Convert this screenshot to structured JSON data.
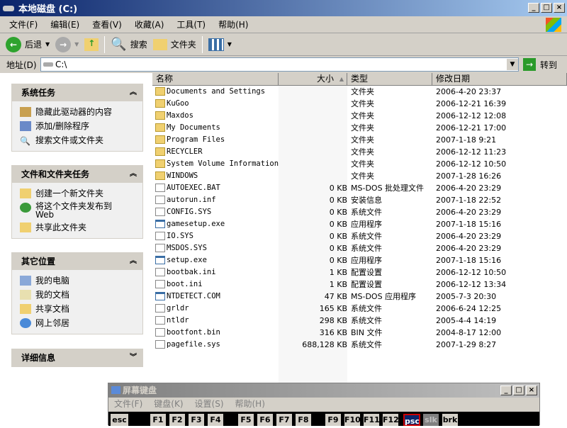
{
  "window": {
    "title": "本地磁盘 (C:)"
  },
  "menu": [
    "文件(F)",
    "编辑(E)",
    "查看(V)",
    "收藏(A)",
    "工具(T)",
    "帮助(H)"
  ],
  "toolbar": {
    "back": "后退",
    "search": "搜索",
    "folders": "文件夹"
  },
  "address": {
    "label": "地址(D)",
    "value": "C:\\",
    "go": "转到"
  },
  "left": {
    "system_tasks": {
      "title": "系统任务",
      "items": [
        "隐藏此驱动器的内容",
        "添加/删除程序",
        "搜索文件或文件夹"
      ]
    },
    "file_tasks": {
      "title": "文件和文件夹任务",
      "items": [
        "创建一个新文件夹",
        "将这个文件夹发布到\nWeb",
        "共享此文件夹"
      ]
    },
    "other_places": {
      "title": "其它位置",
      "items": [
        "我的电脑",
        "我的文档",
        "共享文档",
        "网上邻居"
      ]
    },
    "details": {
      "title": "详细信息"
    }
  },
  "columns": [
    "名称",
    "大小",
    "类型",
    "修改日期"
  ],
  "files": [
    [
      "Documents and Settings",
      "",
      "文件夹",
      "2006-4-20 23:37",
      "folder"
    ],
    [
      "KuGoo",
      "",
      "文件夹",
      "2006-12-21 16:39",
      "folder"
    ],
    [
      "Maxdos",
      "",
      "文件夹",
      "2006-12-12 12:08",
      "folder"
    ],
    [
      "My Documents",
      "",
      "文件夹",
      "2006-12-21 17:00",
      "folder"
    ],
    [
      "Program Files",
      "",
      "文件夹",
      "2007-1-18 9:21",
      "folder"
    ],
    [
      "RECYCLER",
      "",
      "文件夹",
      "2006-12-12 11:23",
      "folder"
    ],
    [
      "System Volume Information",
      "",
      "文件夹",
      "2006-12-12 10:50",
      "folder"
    ],
    [
      "WINDOWS",
      "",
      "文件夹",
      "2007-1-28 16:26",
      "folder"
    ],
    [
      "AUTOEXEC.BAT",
      "0 KB",
      "MS-DOS 批处理文件",
      "2006-4-20 23:29",
      "file"
    ],
    [
      "autorun.inf",
      "0 KB",
      "安装信息",
      "2007-1-18 22:52",
      "file"
    ],
    [
      "CONFIG.SYS",
      "0 KB",
      "系统文件",
      "2006-4-20 23:29",
      "file"
    ],
    [
      "gamesetup.exe",
      "0 KB",
      "应用程序",
      "2007-1-18 15:16",
      "exe"
    ],
    [
      "IO.SYS",
      "0 KB",
      "系统文件",
      "2006-4-20 23:29",
      "file"
    ],
    [
      "MSDOS.SYS",
      "0 KB",
      "系统文件",
      "2006-4-20 23:29",
      "file"
    ],
    [
      "setup.exe",
      "0 KB",
      "应用程序",
      "2007-1-18 15:16",
      "exe"
    ],
    [
      "bootbak.ini",
      "1 KB",
      "配置设置",
      "2006-12-12 10:50",
      "file"
    ],
    [
      "boot.ini",
      "1 KB",
      "配置设置",
      "2006-12-12 13:34",
      "file"
    ],
    [
      "NTDETECT.COM",
      "47 KB",
      "MS-DOS 应用程序",
      "2005-7-3 20:30",
      "exe"
    ],
    [
      "grldr",
      "165 KB",
      "系统文件",
      "2006-6-24 12:25",
      "file"
    ],
    [
      "ntldr",
      "298 KB",
      "系统文件",
      "2005-4-4 14:19",
      "file"
    ],
    [
      "bootfont.bin",
      "316 KB",
      "BIN 文件",
      "2004-8-17 12:00",
      "file"
    ],
    [
      "pagefile.sys",
      "688,128 KB",
      "系统文件",
      "2007-1-29 8:27",
      "file"
    ]
  ],
  "osk": {
    "title": "屏幕键盘",
    "menu": [
      "文件(F)",
      "键盘(K)",
      "设置(S)",
      "帮助(H)"
    ],
    "keys": [
      "esc",
      "F1",
      "F2",
      "F3",
      "F4",
      "F5",
      "F6",
      "F7",
      "F8",
      "F9",
      "F10",
      "F11",
      "F12",
      "psc",
      "slk",
      "brk"
    ]
  }
}
